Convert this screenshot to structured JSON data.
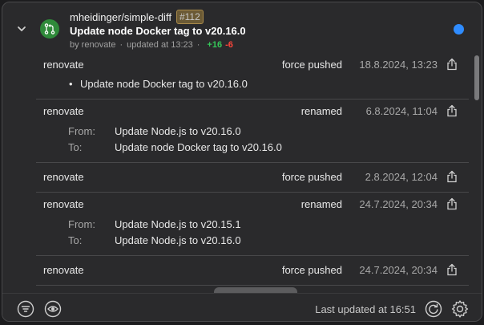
{
  "header": {
    "repo": "mheidinger/simple-diff",
    "pr_number": "#112",
    "title": "Update node Docker tag to v20.16.0",
    "author_text": "by renovate",
    "updated_text": "updated at 13:23",
    "sep": "·",
    "additions": "+16",
    "deletions": "-6"
  },
  "events": [
    {
      "actor": "renovate",
      "action": "force pushed",
      "time": "18.8.2024, 13:23",
      "bullets": [
        "Update node Docker tag to v20.16.0"
      ]
    },
    {
      "actor": "renovate",
      "action": "renamed",
      "time": "6.8.2024, 11:04",
      "from_label": "From:",
      "from": "Update Node.js to v20.16.0",
      "to_label": "To:",
      "to": "Update node Docker tag to v20.16.0"
    },
    {
      "actor": "renovate",
      "action": "force pushed",
      "time": "2.8.2024, 12:04"
    },
    {
      "actor": "renovate",
      "action": "renamed",
      "time": "24.7.2024, 20:34",
      "from_label": "From:",
      "from": "Update Node.js to v20.15.1",
      "to_label": "To:",
      "to": "Update Node.js to v20.16.0"
    },
    {
      "actor": "renovate",
      "action": "force pushed",
      "time": "24.7.2024, 20:34"
    }
  ],
  "footer": {
    "status": "Last updated at 16:51"
  },
  "colors": {
    "unread": "#2f8cff",
    "pr_icon": "#2f8a3a",
    "additions": "#35c759",
    "deletions": "#ff453a"
  }
}
